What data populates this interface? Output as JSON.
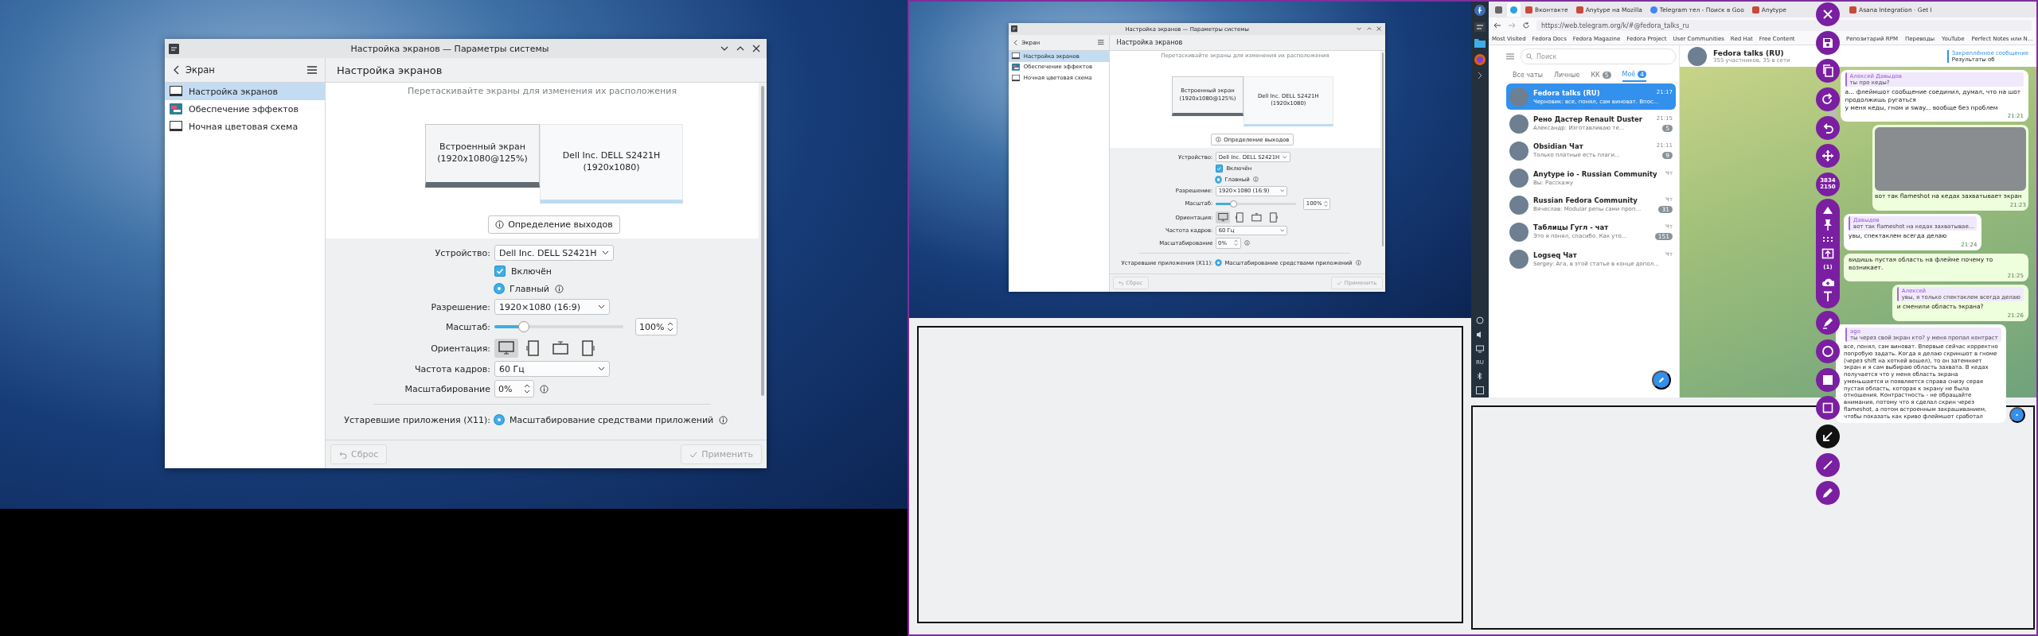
{
  "settings_window": {
    "title": "Настройка экранов — Параметры системы",
    "back_label": "Экран",
    "nav": [
      {
        "label": "Настройка экранов",
        "kind": "display",
        "selected": true
      },
      {
        "label": "Обеспечение эффектов",
        "kind": "effects",
        "selected": false
      },
      {
        "label": "Ночная цветовая схема",
        "kind": "display",
        "selected": false
      }
    ],
    "page_title": "Настройка экранов",
    "hint": "Перетаскивайте экраны для изменения их расположения",
    "screens": [
      {
        "name": "Встроенный экран",
        "mode": "(1920x1080@125%)",
        "selected": false
      },
      {
        "name": "Dell Inc. DELL S2421H",
        "mode": "(1920x1080)",
        "selected": true
      }
    ],
    "identify_button": "Определение выходов",
    "device": {
      "label": "Устройство:",
      "value": "Dell Inc. DELL S2421H"
    },
    "enabled": {
      "label": "Включён",
      "checked": true
    },
    "primary": {
      "label": "Главный",
      "selected": true
    },
    "resolution": {
      "label": "Разрешение:",
      "value": "1920×1080 (16:9)"
    },
    "scale": {
      "label": "Масштаб:",
      "level": 0.23,
      "value": "100%"
    },
    "orientation": {
      "label": "Ориентация:",
      "options": [
        {
          "kind": "landscape",
          "selected": true
        },
        {
          "kind": "portrait-left",
          "selected": false
        },
        {
          "kind": "flipped",
          "selected": false
        },
        {
          "kind": "portrait-right",
          "selected": false
        }
      ]
    },
    "refresh": {
      "label": "Частота кадров:",
      "value": "60 Гц"
    },
    "overscan": {
      "label": "Масштабирование",
      "value": "0%"
    },
    "legacy": {
      "label": "Устаревшие приложения (X11):",
      "option": "Масштабирование средствами приложений",
      "selected": true
    },
    "reset_button": {
      "label": "Сброс",
      "disabled": true
    },
    "apply_button": {
      "label": "Применить",
      "disabled": true
    }
  },
  "preview_window": {
    "title": "Настройка экранов — Параметры системы",
    "back_label": "Экран",
    "nav": [
      {
        "label": "Настройка экранов",
        "kind": "display",
        "selected": true
      },
      {
        "label": "Обеспечение эффектов",
        "kind": "effects",
        "selected": false
      },
      {
        "label": "Ночная цветовая схема",
        "kind": "display",
        "selected": false
      }
    ],
    "page_title": "Настройка экранов",
    "hint": "Перетаскивайте экраны для изменения их расположения",
    "screens": [
      {
        "name": "Встроенный экран",
        "mode": "(1920x1080@125%)",
        "selected": false
      },
      {
        "name": "Dell Inc. DELL S2421H",
        "mode": "(1920x1080)",
        "selected": true
      }
    ],
    "identify_button": "Определение выходов",
    "device": {
      "label": "Устройство:",
      "value": "Dell Inc. DELL S2421H"
    },
    "enabled": {
      "label": "Включён",
      "checked": true
    },
    "primary": {
      "label": "Главный",
      "selected": true
    },
    "resolution": {
      "label": "Разрешение:",
      "value": "1920×1080 (16:9)"
    },
    "scale": {
      "label": "Масштаб:",
      "level": 0.23,
      "value": "100%"
    },
    "orientation": {
      "label": "Ориентация:",
      "options": [
        {
          "kind": "landscape",
          "selected": true
        },
        {
          "kind": "portrait-left",
          "selected": false
        },
        {
          "kind": "flipped",
          "selected": false
        },
        {
          "kind": "portrait-right",
          "selected": false
        }
      ]
    },
    "refresh": {
      "label": "Частота кадров:",
      "value": "60 Гц"
    },
    "overscan": {
      "label": "Масштабирование",
      "value": "0%"
    },
    "legacy": {
      "label": "Устаревшие приложения (X11):",
      "option": "Масштабирование средствами приложений",
      "selected": true
    },
    "reset_button": {
      "label": "Сброс",
      "disabled": true
    },
    "apply_button": {
      "label": "Применить",
      "disabled": true
    }
  },
  "browser": {
    "tabs": [
      [
        {
          "kind": "pinned",
          "selected": false
        },
        {
          "kind": "telegram",
          "selected": true
        },
        {
          "title": "Вконтакте",
          "kind": "page",
          "selected": false
        },
        {
          "title": "Anytype на Mozilla",
          "kind": "page",
          "selected": false
        },
        {
          "title": "Telegram тел - Поиск в Goo",
          "kind": "google",
          "selected": false
        },
        {
          "title": "Anytype",
          "kind": "page",
          "selected": false
        }
      ],
      [
        {
          "title": "Asana Integration · Get I",
          "kind": "page",
          "selected": false
        }
      ]
    ],
    "url": "https://web.telegram.org/k/#@fedora_talks_ru",
    "bookmarks": [
      [
        "Most Visited",
        "Fedora Docs",
        "Fedora Magazine",
        "Fedora Project",
        "User Communities",
        "Red Hat",
        "Free Content"
      ],
      [
        "Репозитарий RPM",
        "Переводы",
        "YouTube",
        "Perfect Notes или N..."
      ]
    ]
  },
  "telegram": {
    "search_placeholder": "Поиск",
    "folders": [
      {
        "label": "Все чаты",
        "selected": false
      },
      {
        "label": "Личные",
        "selected": false
      },
      {
        "label": "КК",
        "badge": "5",
        "selected": false
      },
      {
        "label": "Моё",
        "badge": "4",
        "selected": true
      }
    ],
    "chats": [
      {
        "name": "Fedora talks (RU)",
        "preview": "Черновик: все, понял, сам виноват. Впос...",
        "time": "21:17",
        "selected": true
      },
      {
        "name": "Рено Дастер Renault Duster",
        "preview": "Александр: Изготавливаю те...",
        "time": "21:15",
        "badge": "5",
        "selected": false
      },
      {
        "name": "Obsidian Чат",
        "preview": "Только платные есть плаги...",
        "time": "21:11",
        "badge": "9",
        "selected": false
      },
      {
        "name": "Anytype io - Russian Community",
        "preview": "Вы: Расскажу",
        "time": "Чт",
        "selected": false
      },
      {
        "name": "Russian Fedora Community",
        "preview": "Вячеслав: Modular репы сами проп...",
        "time": "Чт",
        "badge": "31",
        "selected": false
      },
      {
        "name": "Таблицы Гугл - чат",
        "preview": "Это я понял, спасибо. Как уто...",
        "time": "Чт",
        "badge": "151",
        "selected": false
      },
      {
        "name": "Logseq Чат",
        "preview": "Sergey: Ага, в этой статье в конце допол...",
        "time": "Чт",
        "selected": false
      }
    ],
    "chat_title": "Fedora talks (RU)",
    "chat_subtitle": "355 участников, 35 в сети",
    "pinned_title": "Закреплённое сообщение",
    "pinned_text": "Результаты об",
    "messages": [
      {
        "kind": "in",
        "reply_name": "Алексей Давыдов",
        "reply_text": "ты про кеды?",
        "text": "а... флеймшот сообщение соединил, думал, что на шот продолжишь ругаться\nу меня кеды, гном и sway... вообще без проблем",
        "time": "21:21"
      },
      {
        "kind": "photo",
        "text": "вот так flameshot на кедах захватывает экран",
        "time": "21:23"
      },
      {
        "kind": "in",
        "reply_name": "Давыдов",
        "reply_text": "вот так flameshot на кедах захватывае...",
        "text": "увы, спектаклем всегда делаю",
        "time": "21:24"
      },
      {
        "kind": "out",
        "text": "видишь пустая область на флейме почему то возникает.",
        "time": "21:25"
      },
      {
        "kind": "out",
        "reply_name": "Алексей",
        "reply_text": "увы, я только спектаклем всегда делаю",
        "text": "и сменили область экрана?",
        "time": "21:26"
      }
    ],
    "draft": {
      "reply_name": "ago",
      "reply_text": "ты через свой экран кто? у меня пропал контраст",
      "text": "все, понял, сам виноват. Впервые сейчас корректно попробую задать. Когда я делаю скриншот в гноме (через shift на хоткей вошел), то он затемняет экран и я сам выбираю область захвата. В кедах получается что у меня область экрана уменьшается и появляется справа снизу серая пустая область, которая к экрану не была отношения. Контрастность - не обращайте внимания, потому что я сделал скрин через flameshot, а потом встроенным закрашиванием, чтобы показать как криво флеймшот сработал"
    }
  },
  "panel": {
    "layout": "RU"
  },
  "toolbar": {
    "main": [
      {
        "kind": "close"
      },
      {
        "kind": "save"
      },
      {
        "kind": "copy"
      },
      {
        "kind": "redo"
      },
      {
        "kind": "undo"
      },
      {
        "kind": "move"
      },
      {
        "kind": "size",
        "lines": [
          "3834",
          "2150"
        ]
      }
    ],
    "cluster": [
      {
        "kind": "launch"
      },
      {
        "kind": "pin"
      },
      {
        "kind": "grid"
      },
      {
        "kind": "window"
      },
      {
        "kind": "counter",
        "label": "(1)"
      },
      {
        "kind": "upload"
      },
      {
        "kind": "text"
      }
    ],
    "tools": [
      {
        "kind": "marker",
        "selected": false
      },
      {
        "kind": "circle",
        "selected": false
      },
      {
        "kind": "filled-square",
        "selected": false
      },
      {
        "kind": "square",
        "selected": false
      },
      {
        "kind": "arrow",
        "selected": true
      },
      {
        "kind": "line",
        "selected": false
      },
      {
        "kind": "pencil",
        "selected": false
      }
    ]
  }
}
